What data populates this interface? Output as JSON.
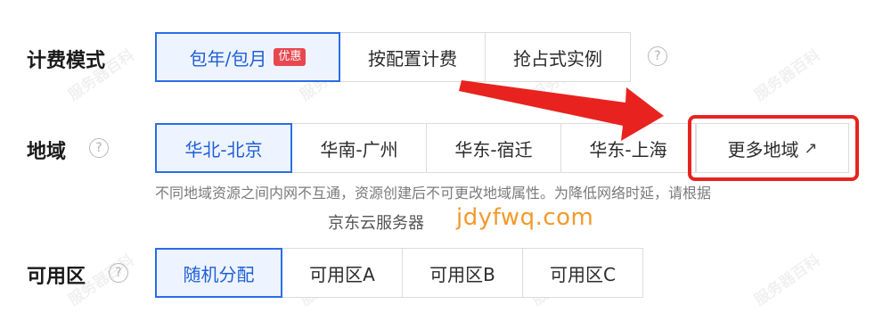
{
  "billing": {
    "label": "计费模式",
    "options": [
      {
        "label": "包年/包月",
        "badge": "优惠"
      },
      {
        "label": "按配置计费"
      },
      {
        "label": "抢占式实例"
      }
    ],
    "help": "?"
  },
  "region": {
    "label": "地域",
    "help": "?",
    "options": [
      "华北-北京",
      "华南-广州",
      "华东-宿迁",
      "华东-上海"
    ],
    "more": "更多地域",
    "note": "不同地域资源之间内网不互通，资源创建后不可更改地域属性。为降低网络时延，请根据"
  },
  "zone": {
    "label": "可用区",
    "help": "?",
    "options": [
      "随机分配",
      "可用区A",
      "可用区B",
      "可用区C"
    ]
  },
  "watermark": {
    "cn": "京东云服务器",
    "en": "jdyfwq.com",
    "stamp": "服务器百科"
  },
  "colors": {
    "accent": "#2b6de8",
    "badge": "#e8474f",
    "annotation": "#e8231f"
  }
}
